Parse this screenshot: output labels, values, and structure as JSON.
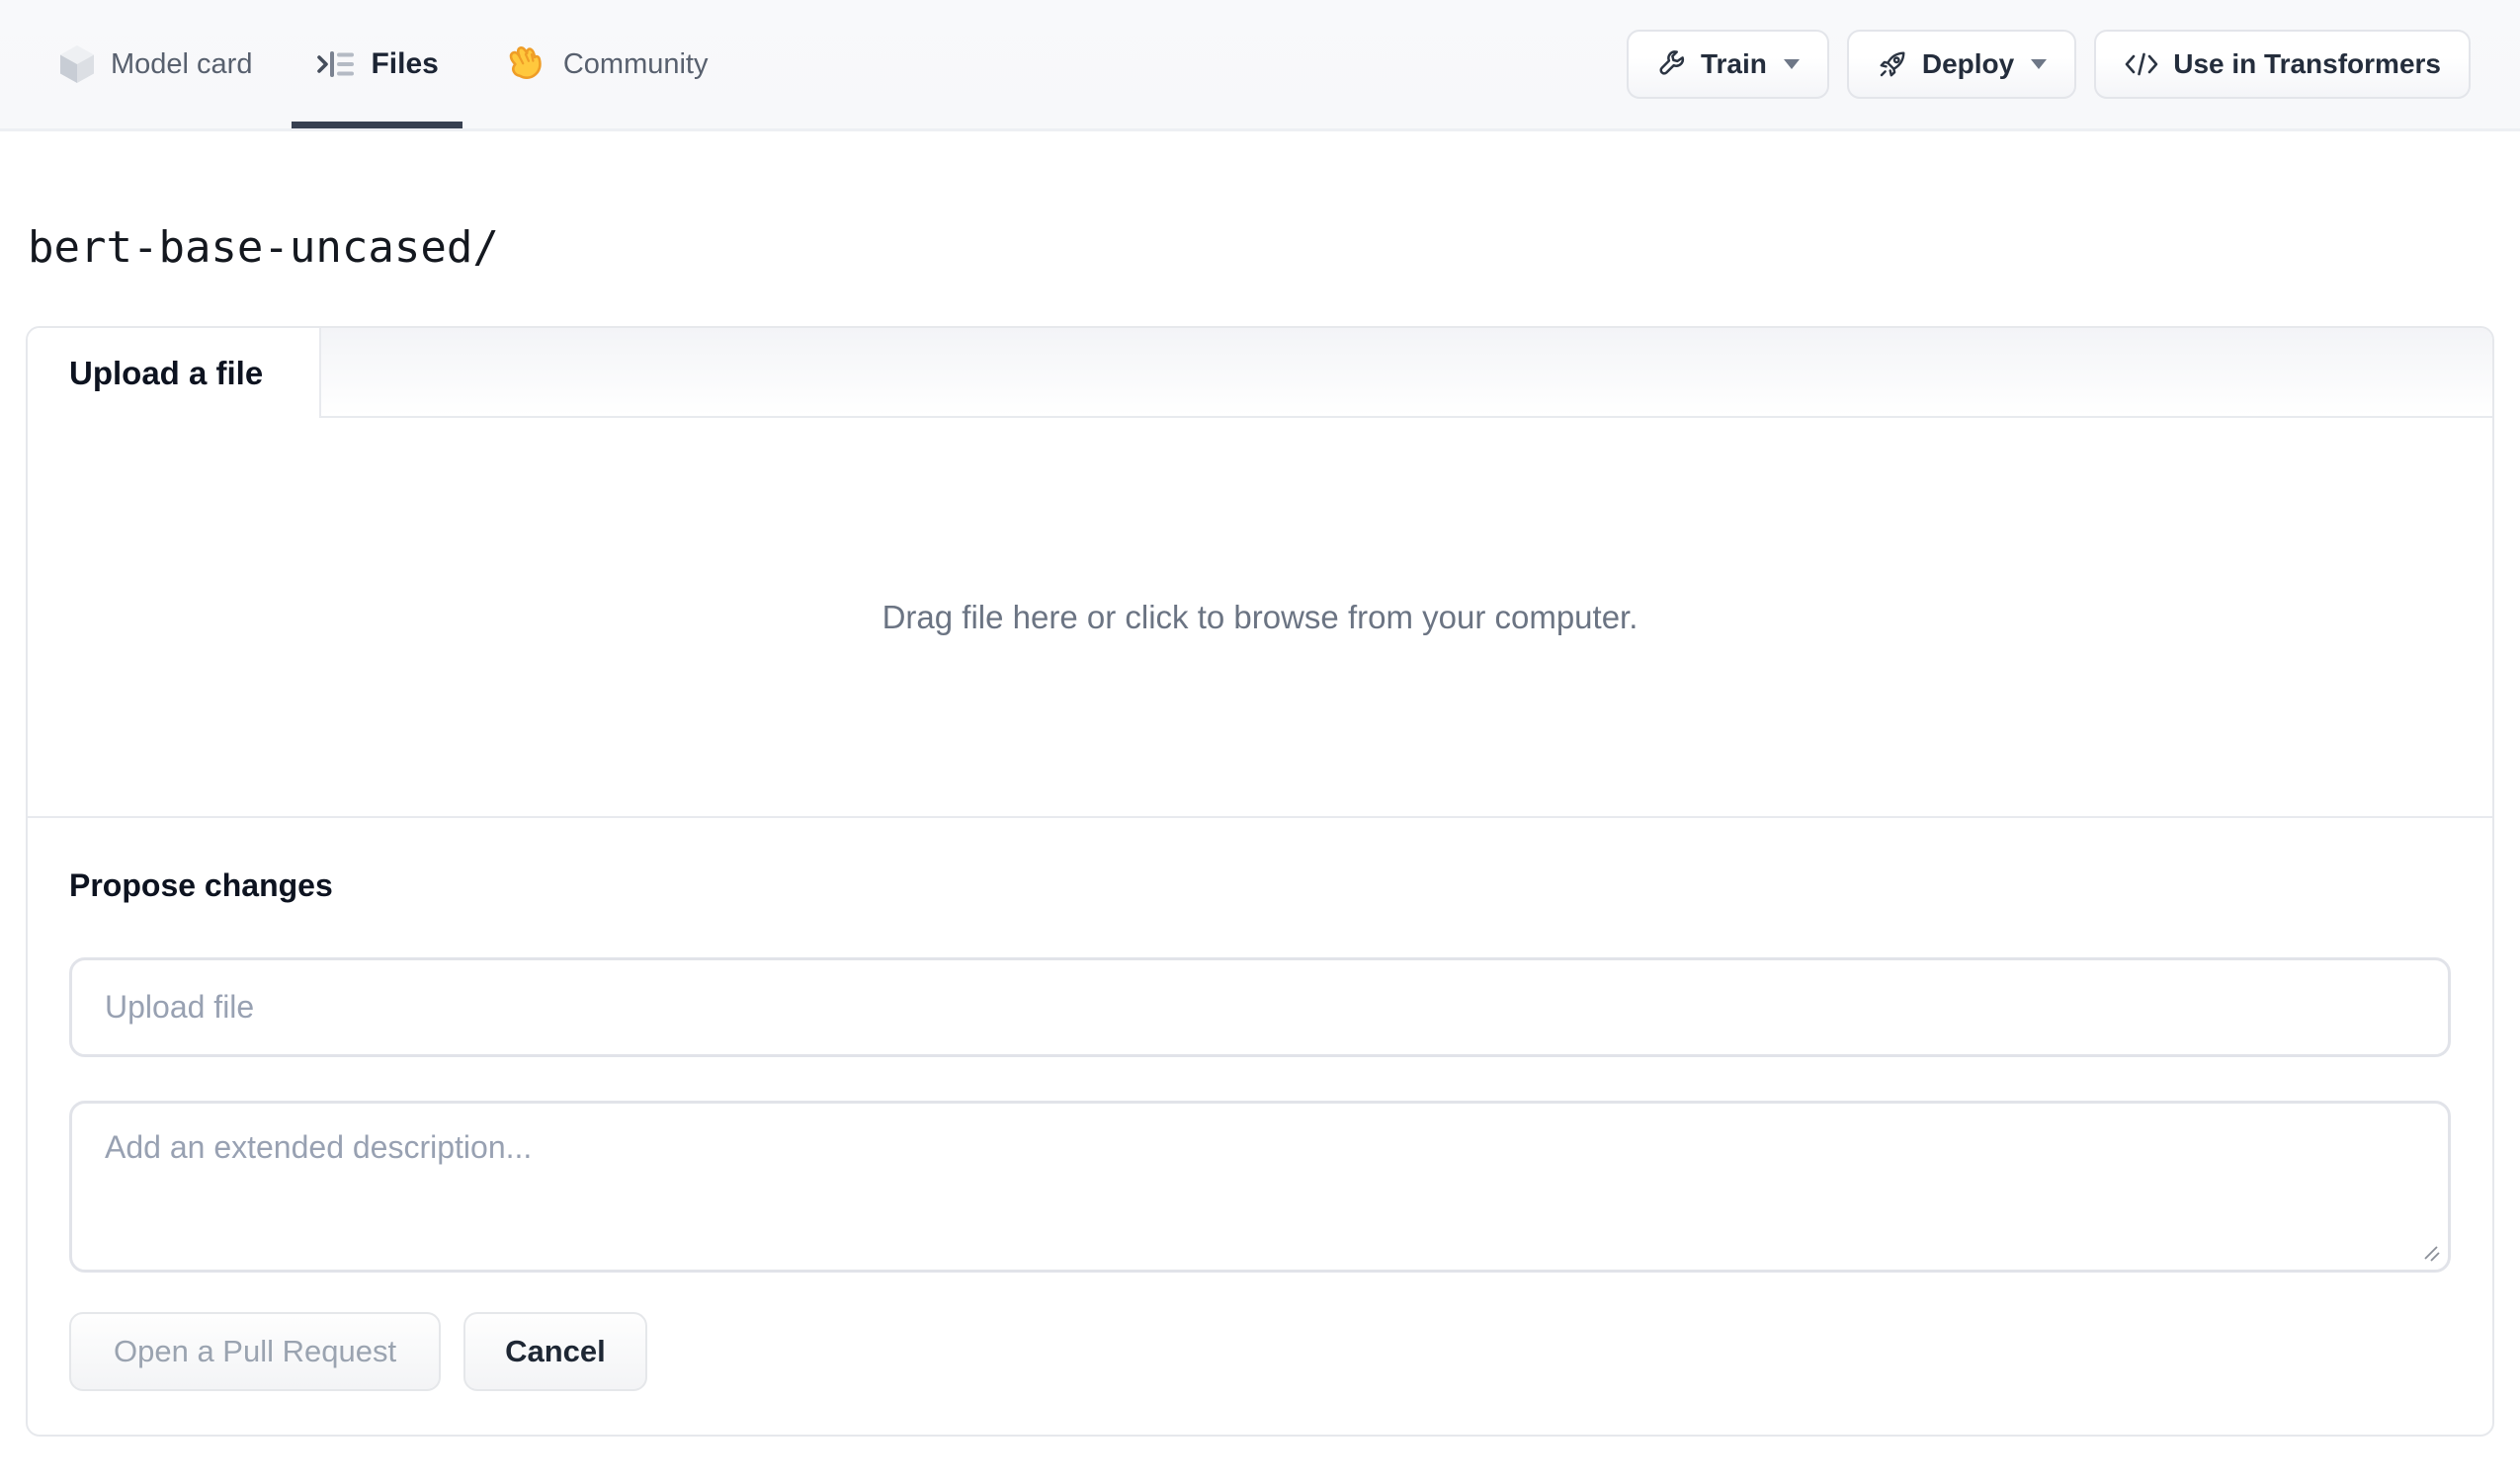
{
  "header": {
    "tabs": [
      {
        "label": "Model card",
        "icon": "cube-icon",
        "active": false
      },
      {
        "label": "Files",
        "icon": "files-icon",
        "active": true
      },
      {
        "label": "Community",
        "icon": "waving-hand-icon",
        "active": false
      }
    ],
    "actions": [
      {
        "label": "Train",
        "icon": "wrench-icon",
        "has_caret": true
      },
      {
        "label": "Deploy",
        "icon": "rocket-icon",
        "has_caret": true
      },
      {
        "label": "Use in Transformers",
        "icon": "code-icon",
        "has_caret": false
      }
    ]
  },
  "path": "bert-base-uncased/",
  "upload_panel": {
    "tab_label": "Upload a file",
    "dropzone_text": "Drag file here or click to browse from your computer."
  },
  "propose": {
    "title": "Propose changes",
    "filename_placeholder": "Upload file",
    "description_placeholder": "Add an extended description...",
    "primary_label": "Open a Pull Request",
    "cancel_label": "Cancel"
  },
  "colors": {
    "topbar_bg": "#f8f9fb",
    "active_tab_underline": "#384151",
    "divider": "#e8eaee",
    "muted_text": "#6b7483",
    "placeholder": "#98a1b2",
    "disabled_button_text": "#9aa3b0",
    "hand_emoji_yellow": "#ffc83d",
    "hand_emoji_orange": "#ef9d27"
  }
}
